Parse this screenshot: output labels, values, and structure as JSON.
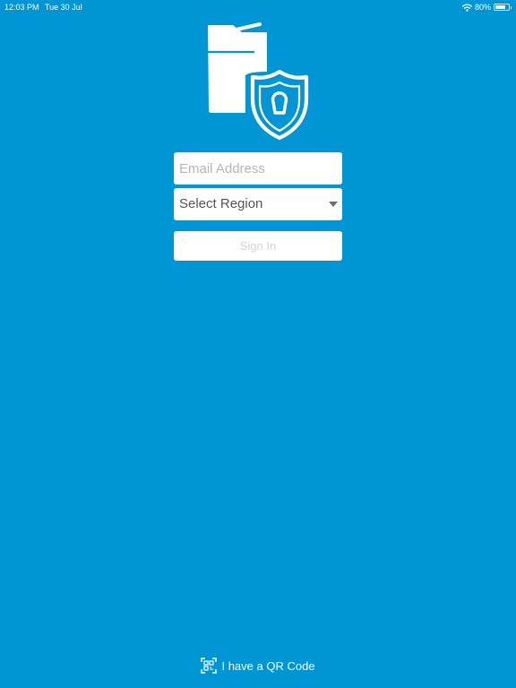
{
  "status_bar": {
    "time": "12:03 PM",
    "date": "Tue 30 Jul",
    "battery_percent": "80%",
    "battery_level": 0.8,
    "wifi_icon": "wifi-icon",
    "battery_icon": "battery-icon"
  },
  "logo": {
    "icon": "printer-shield-lock-logo"
  },
  "login_form": {
    "email_placeholder": "Email Address",
    "email_value": "",
    "region_label": "Select Region",
    "signin_label": "Sign In"
  },
  "qr": {
    "icon": "qr-scan-icon",
    "label": "I have a QR Code"
  },
  "colors": {
    "background": "#0096d6",
    "field_background": "#ffffff",
    "placeholder_text": "#b5b5b5",
    "disabled_button_text": "#d3d3d3"
  }
}
